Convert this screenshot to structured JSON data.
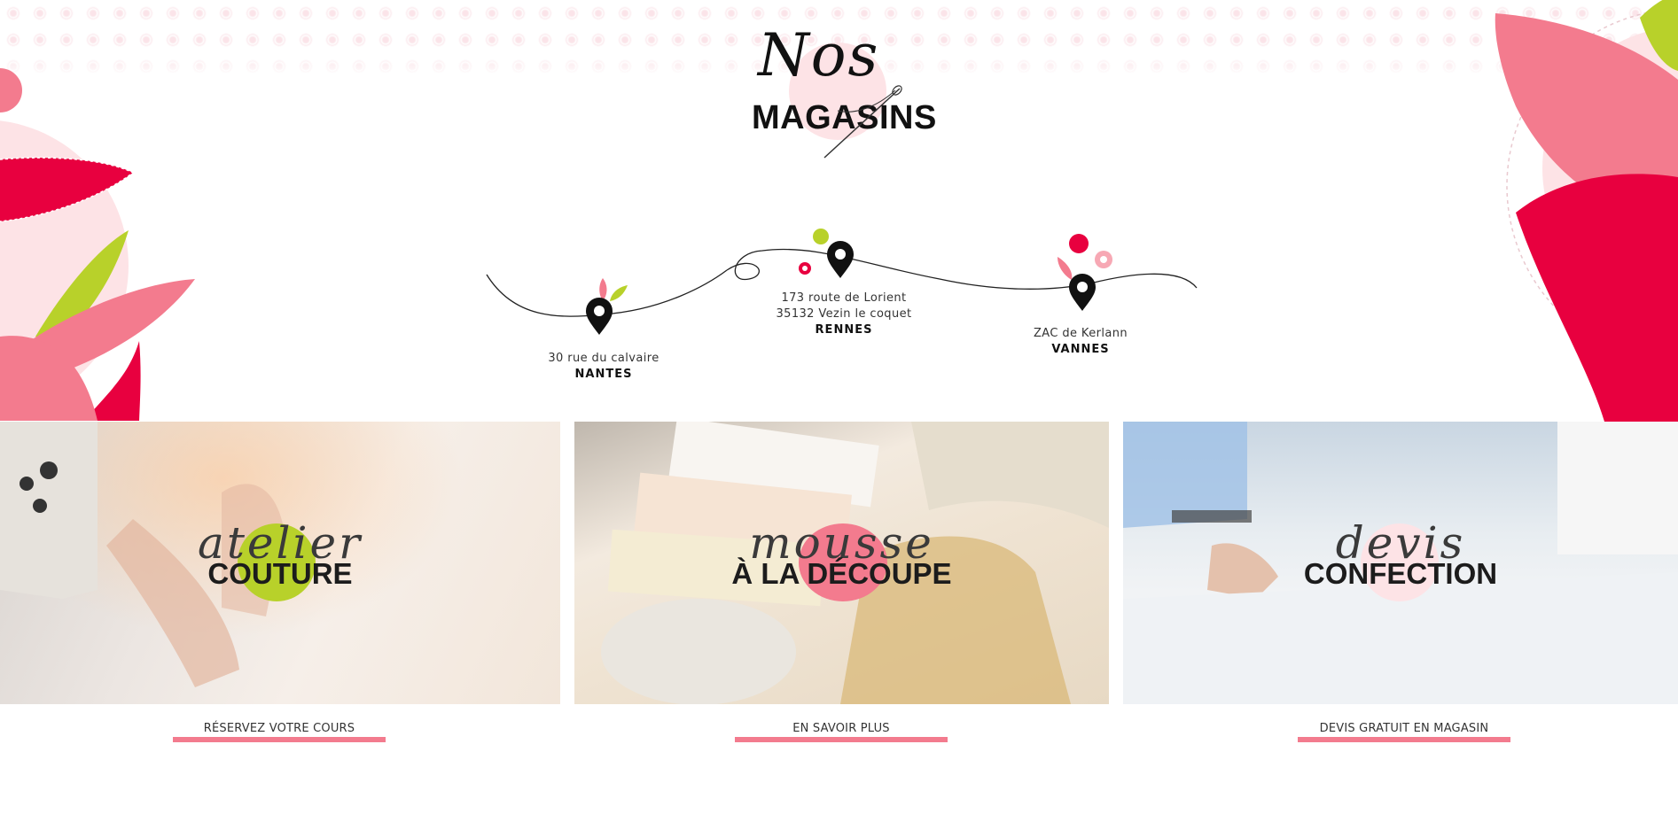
{
  "header": {
    "title_script": "Nos",
    "title_main": "MAGASINS"
  },
  "stores": [
    {
      "address": "30 rue du calvaire",
      "address2": "",
      "city": "NANTES"
    },
    {
      "address": "173 route de Lorient",
      "address2": "35132 Vezin le coquet",
      "city": "RENNES"
    },
    {
      "address": "ZAC de Kerlann",
      "address2": "",
      "city": "VANNES"
    }
  ],
  "services": [
    {
      "script": "atelier",
      "main": "COUTURE",
      "cta": "RÉSERVEZ VOTRE COURS",
      "accent": "#b8d12a"
    },
    {
      "script": "mousse",
      "main": "À LA DÉCOUPE",
      "cta": "EN SAVOIR PLUS",
      "accent": "#f37b8e"
    },
    {
      "script": "devis",
      "main": "CONFECTION",
      "cta": "DEVIS GRATUIT EN MAGASIN",
      "accent": "#fde3e6"
    }
  ],
  "colors": {
    "brand_pink": "#f37b8e",
    "brand_red": "#e8003f",
    "brand_green": "#b8d12a",
    "pale_pink": "#fde3e6"
  },
  "icons": [
    "map-pin-icon",
    "needle-icon",
    "flower-icon",
    "leaf-icon"
  ]
}
